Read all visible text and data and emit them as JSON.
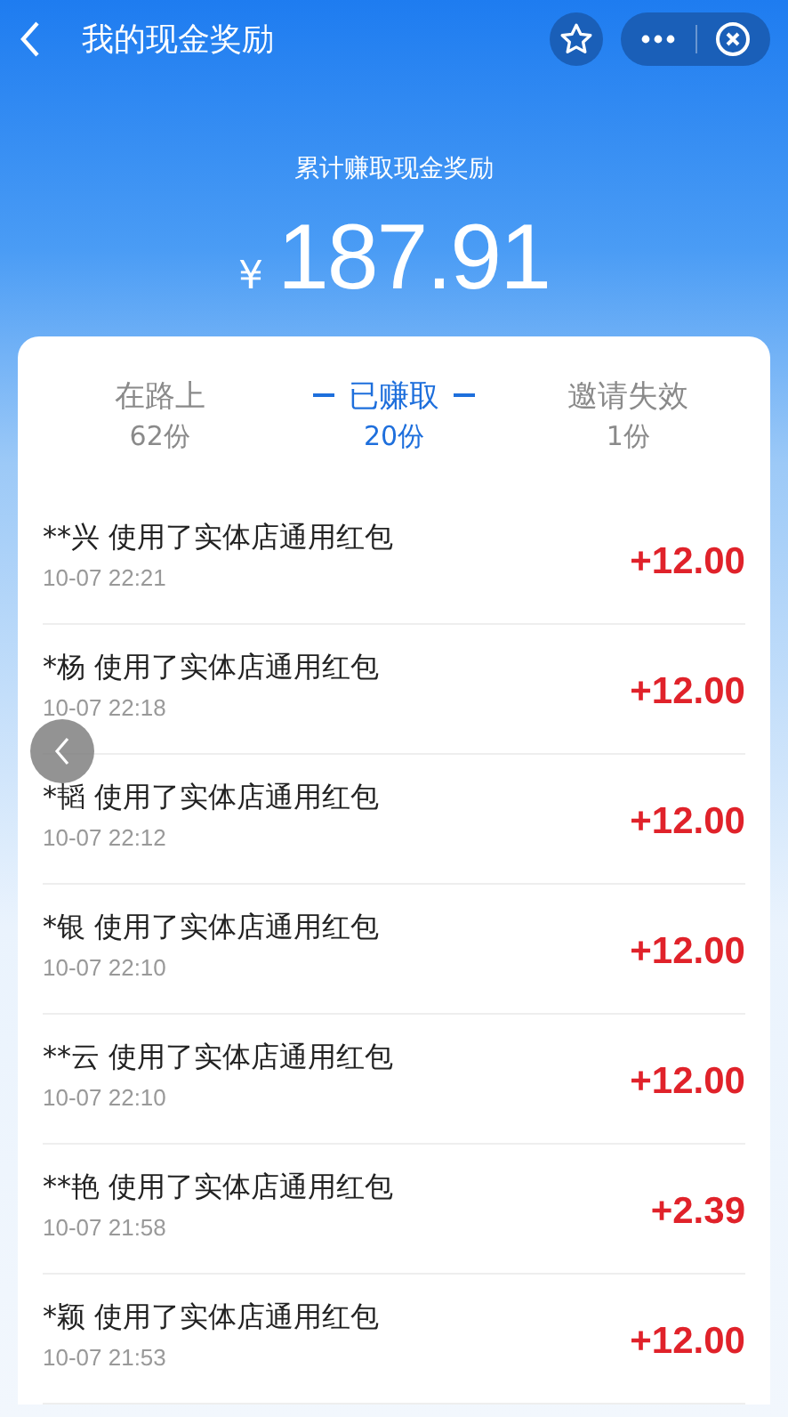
{
  "header": {
    "title": "我的现金奖励"
  },
  "summary": {
    "label": "累计赚取现金奖励",
    "currency": "¥",
    "amount": "187.91"
  },
  "tabs": [
    {
      "label": "在路上",
      "count": "62份",
      "selected": false
    },
    {
      "label": "已赚取",
      "count": "20份",
      "selected": true
    },
    {
      "label": "邀请失效",
      "count": "1份",
      "selected": false
    }
  ],
  "records": [
    {
      "text": "**兴 使用了实体店通用红包",
      "time": "10-07 22:21",
      "amount": "+12.00"
    },
    {
      "text": "*杨 使用了实体店通用红包",
      "time": "10-07 22:18",
      "amount": "+12.00"
    },
    {
      "text": "*韬 使用了实体店通用红包",
      "time": "10-07 22:12",
      "amount": "+12.00"
    },
    {
      "text": "*银 使用了实体店通用红包",
      "time": "10-07 22:10",
      "amount": "+12.00"
    },
    {
      "text": "**云 使用了实体店通用红包",
      "time": "10-07 22:10",
      "amount": "+12.00"
    },
    {
      "text": "**艳 使用了实体店通用红包",
      "time": "10-07 21:58",
      "amount": "+2.39"
    },
    {
      "text": "*颖 使用了实体店通用红包",
      "time": "10-07 21:53",
      "amount": "+12.00"
    }
  ]
}
